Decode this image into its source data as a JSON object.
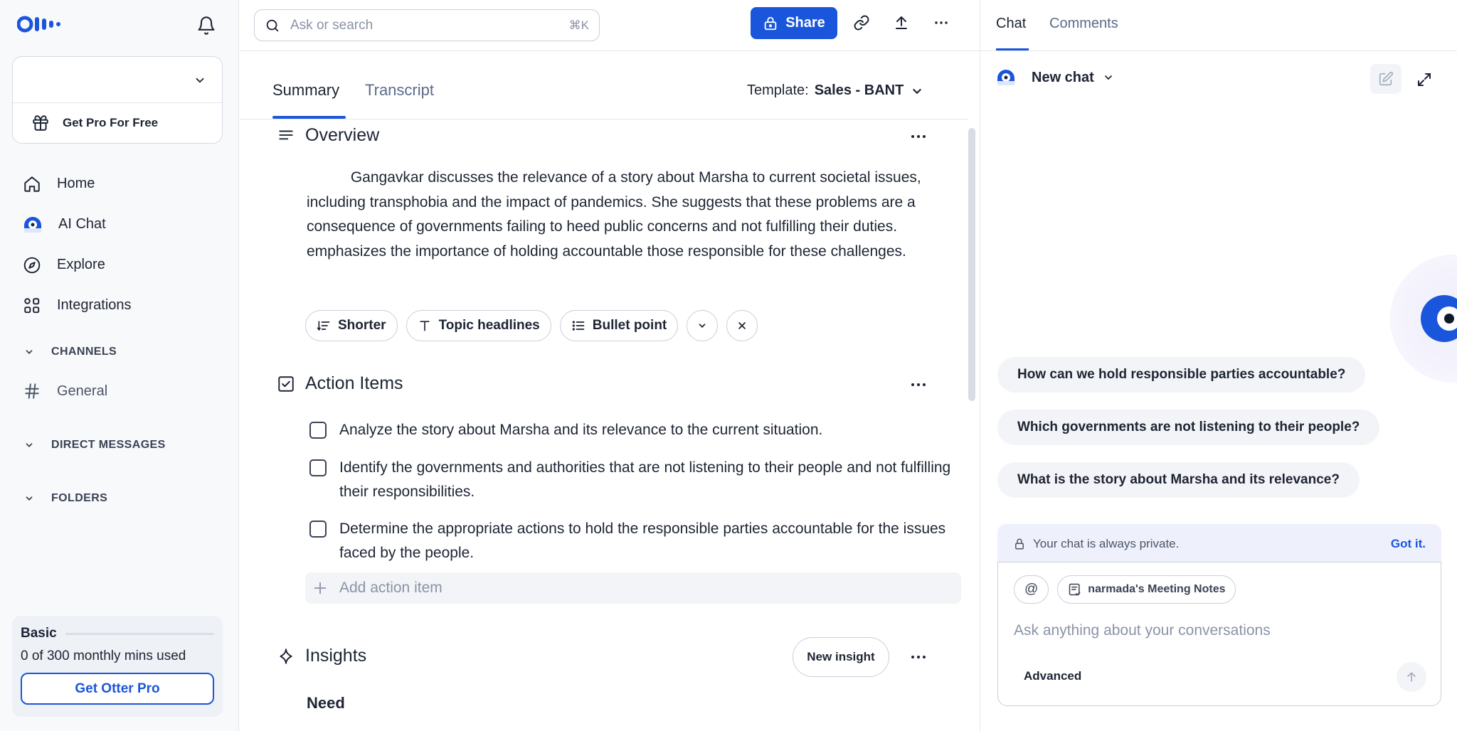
{
  "sidebar": {
    "pro_free": "Get Pro For Free",
    "nav": [
      {
        "label": "Home",
        "icon": "home-icon"
      },
      {
        "label": "AI Chat",
        "icon": "otter-chat-icon"
      },
      {
        "label": "Explore",
        "icon": "compass-icon"
      },
      {
        "label": "Integrations",
        "icon": "grid-icon"
      }
    ],
    "sections": {
      "channels": "CHANNELS",
      "direct_messages": "DIRECT MESSAGES",
      "folders": "FOLDERS"
    },
    "channel_general": "General",
    "plan": {
      "name": "Basic",
      "usage_count": "0 of 300",
      "usage_suffix": "monthly mins used",
      "cta": "Get Otter Pro"
    }
  },
  "topbar": {
    "search_placeholder": "Ask or search",
    "shortcut": "⌘K",
    "share_label": "Share"
  },
  "tabs": {
    "summary": "Summary",
    "transcript": "Transcript",
    "template_label": "Template:",
    "template_value": "Sales - BANT"
  },
  "overview": {
    "title": "Overview",
    "text_part1": "Gangavkar discusses the relevance of a story about Marsha to current societal issues, including transphobia and the impact of pandemics. She suggests that these problems are a consequence of governments failing to heed public concerns and not fulfilling their duties.",
    "text_part2": "emphasizes the importance of holding accountable those responsible for these challenges.",
    "chips": [
      "Shorter",
      "Topic headlines",
      "Bullet point"
    ]
  },
  "action_items": {
    "title": "Action Items",
    "items": [
      "Analyze the story about Marsha and its relevance to the current situation.",
      "Identify the governments and authorities that are not listening to their people and not fulfilling their responsibilities.",
      "Determine the appropriate actions to hold the responsible parties accountable for the issues faced by the people."
    ],
    "add_placeholder": "Add action item"
  },
  "insights": {
    "title": "Insights",
    "new_button": "New insight",
    "first_heading": "Need"
  },
  "right_panel": {
    "tab_chat": "Chat",
    "tab_comments": "Comments",
    "new_chat": "New chat",
    "suggestions": [
      "How can we hold responsible parties accountable?",
      "Which governments are not listening to their people?",
      "What is the story about Marsha and its relevance?"
    ],
    "privacy_text": "Your chat is always private.",
    "privacy_dismiss": "Got it.",
    "mention_symbol": "@",
    "context_chip": "narmada's Meeting Notes",
    "input_placeholder": "Ask anything about your conversations",
    "advanced": "Advanced"
  },
  "colors": {
    "accent": "#1a56db",
    "text": "#1d2433",
    "muted": "#8a93a6"
  }
}
